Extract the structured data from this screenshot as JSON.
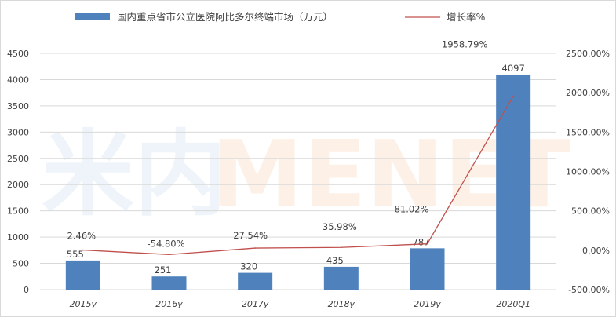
{
  "chart_data": {
    "type": "bar",
    "categories": [
      "2015y",
      "2016y",
      "2017y",
      "2018y",
      "2019y",
      "2020Q1"
    ],
    "series": [
      {
        "name": "国内重点省市公立医院阿比多尔终端市场（万元）",
        "type": "bar",
        "axis": "left",
        "values": [
          555,
          251,
          320,
          435,
          787,
          4097
        ],
        "labels": [
          "555",
          "251",
          "320",
          "435",
          "787",
          "4097"
        ],
        "color": "#4f81bd"
      },
      {
        "name": "增长率%",
        "type": "line",
        "axis": "right",
        "values": [
          2.46,
          -54.8,
          27.54,
          35.98,
          81.02,
          1958.79
        ],
        "labels": [
          "2.46%",
          "-54.80%",
          "27.54%",
          "35.98%",
          "81.02%",
          "1958.79%"
        ],
        "color": "#c0504d"
      }
    ],
    "left_axis": {
      "ylim": [
        0,
        4500
      ],
      "ticks": [
        "0",
        "500",
        "1000",
        "1500",
        "2000",
        "2500",
        "3000",
        "3500",
        "4000",
        "4500"
      ]
    },
    "right_axis": {
      "ylim": [
        -500,
        2500
      ],
      "ticks": [
        "-500.00%",
        "0.00%",
        "500.00%",
        "1000.00%",
        "1500.00%",
        "2000.00%",
        "2500.00%"
      ]
    },
    "grid": true,
    "legend_position": "top",
    "watermark": "米内MENET"
  }
}
